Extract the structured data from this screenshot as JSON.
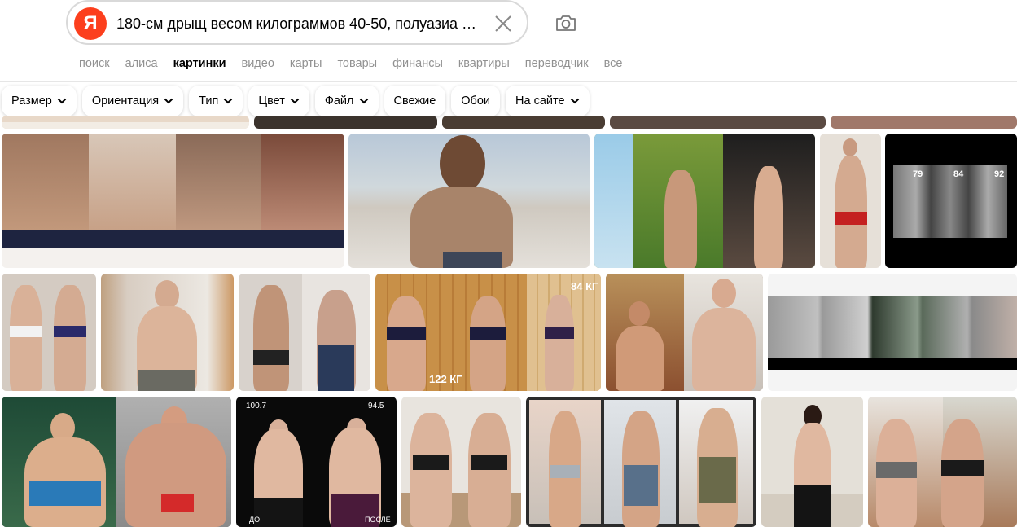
{
  "search": {
    "logo": "Я",
    "query": "180-см дрыщ весом килограммов 40-50, полуазиа …"
  },
  "tabs": [
    {
      "label": "поиск",
      "active": false
    },
    {
      "label": "алиса",
      "active": false
    },
    {
      "label": "картинки",
      "active": true
    },
    {
      "label": "видео",
      "active": false
    },
    {
      "label": "карты",
      "active": false
    },
    {
      "label": "товары",
      "active": false
    },
    {
      "label": "финансы",
      "active": false
    },
    {
      "label": "квартиры",
      "active": false
    },
    {
      "label": "переводчик",
      "active": false
    },
    {
      "label": "все",
      "active": false
    }
  ],
  "filters": [
    {
      "label": "Размер",
      "dropdown": true
    },
    {
      "label": "Ориентация",
      "dropdown": true
    },
    {
      "label": "Тип",
      "dropdown": true
    },
    {
      "label": "Цвет",
      "dropdown": true
    },
    {
      "label": "Файл",
      "dropdown": true
    },
    {
      "label": "Свежие",
      "dropdown": false
    },
    {
      "label": "Обои",
      "dropdown": false
    },
    {
      "label": "На сайте",
      "dropdown": true
    }
  ],
  "overlays": {
    "kg84": "84 КГ",
    "kg122": "122 КГ",
    "w1007": "100.7",
    "w945": "94.5",
    "do": "ДО",
    "posle": "ПОСЛЕ",
    "n79": "79",
    "n84": "84",
    "n92": "92"
  },
  "colors": {
    "logo": "#fc3f1d",
    "accent": "#000000",
    "muted": "#919191"
  }
}
